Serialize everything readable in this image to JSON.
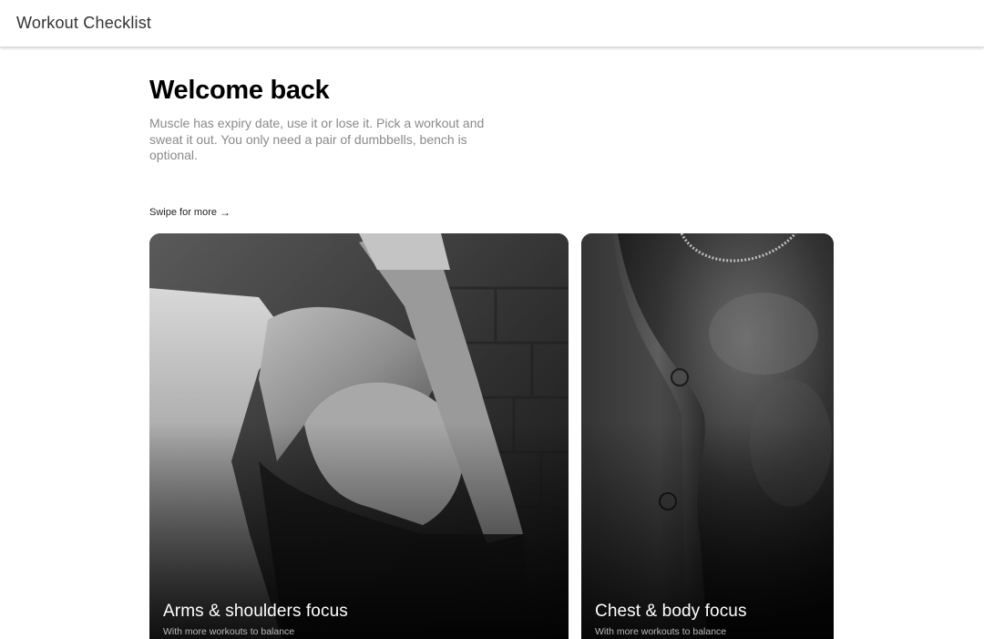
{
  "appbar": {
    "title": "Workout Checklist"
  },
  "hero": {
    "title": "Welcome back",
    "description": "Muscle has expiry date, use it or lose it. Pick a workout and sweat it out. You only need a pair of dumbbells, bench is optional."
  },
  "carousel": {
    "hint": "Swipe for more",
    "hint_icon": "arrow-right-icon",
    "cards": [
      {
        "title": "Arms & shoulders focus",
        "subtitle": "With more workouts to balance"
      },
      {
        "title": "Chest & body focus",
        "subtitle": "With more workouts to balance"
      }
    ]
  }
}
